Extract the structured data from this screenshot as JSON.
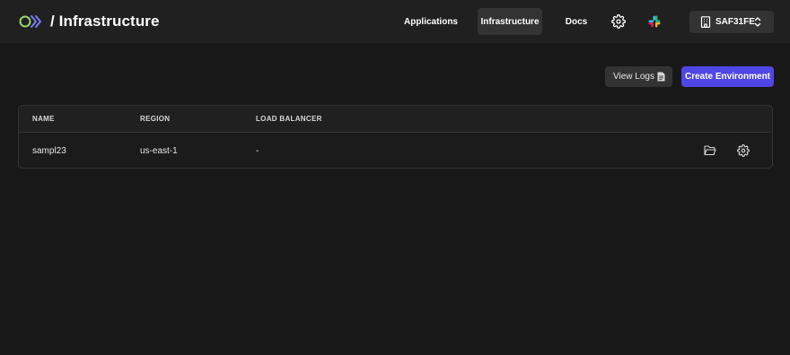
{
  "header": {
    "logo_icon": "logo-icon",
    "title": "/ Infrastructure",
    "nav": [
      {
        "label": "Applications",
        "active": false
      },
      {
        "label": "Infrastructure",
        "active": true
      },
      {
        "label": "Docs",
        "active": false
      }
    ],
    "settings_icon": "gear-icon",
    "slack_icon": "slack-icon",
    "org": {
      "label": "SAF31FE",
      "icon": "building-icon",
      "chevron_icon": "chevron-up-down-icon"
    }
  },
  "actions": {
    "view_logs_label": "View Logs",
    "view_logs_icon": "document-icon",
    "create_label": "Create Environment"
  },
  "table": {
    "columns": [
      "NAME",
      "REGION",
      "LOAD BALANCER"
    ],
    "rows": [
      {
        "name": "sampl23",
        "region": "us-east-1",
        "load_balancer": "-",
        "actions": [
          "folder-icon",
          "gear-icon"
        ]
      }
    ]
  },
  "colors": {
    "background": "#181818",
    "header": "#202020",
    "active_nav": "#333333",
    "primary": "#5046e5",
    "logo_green": "#9bd36b",
    "logo_purple": "#7b7cf3"
  }
}
